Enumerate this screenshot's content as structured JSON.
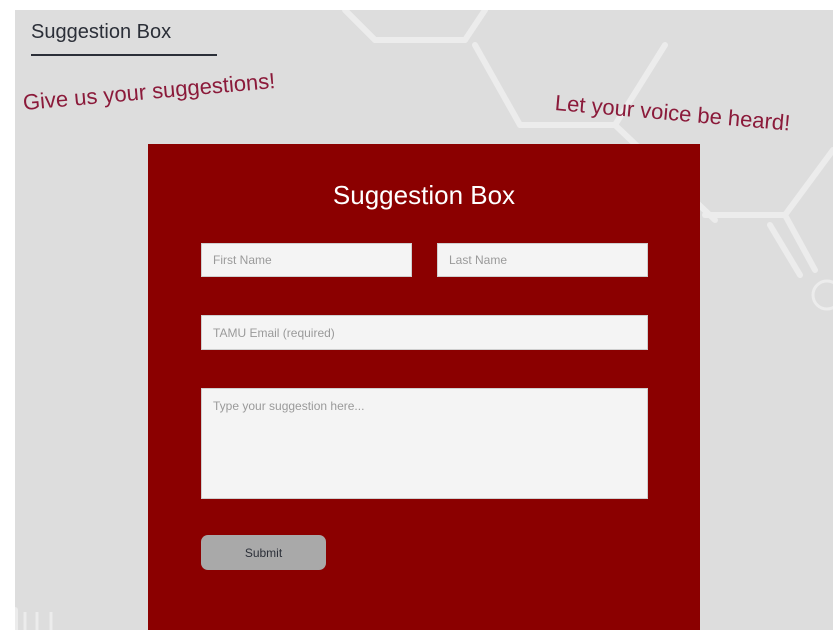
{
  "header": {
    "title": "Suggestion Box"
  },
  "taglines": {
    "left": "Give us your suggestions!",
    "right": "Let your voice be heard!"
  },
  "form": {
    "title": "Suggestion Box",
    "first_name_placeholder": "First Name",
    "last_name_placeholder": "Last Name",
    "email_placeholder": "TAMU Email (required)",
    "message_placeholder": "Type your suggestion here...",
    "submit_label": "Submit"
  },
  "colors": {
    "card_background": "#8b0000",
    "tagline": "#8b1a3a",
    "page_background": "#dddddd",
    "submit_background": "#a9a9a9"
  }
}
